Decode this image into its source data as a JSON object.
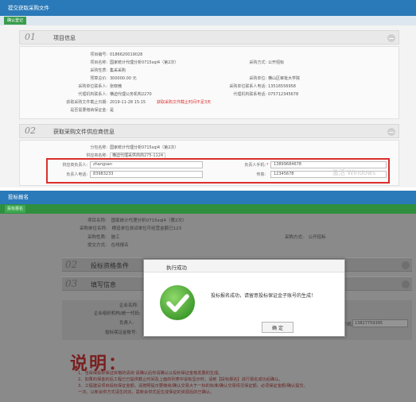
{
  "panel1": {
    "title": "提交获取采购文件",
    "toolbar": {
      "confirm_label": "确认登记"
    },
    "section1": {
      "num": "01",
      "title": "项目信息",
      "fields_left": [
        {
          "label": "项目编号:",
          "value": "0186620019028"
        },
        {
          "label": "项目名称:",
          "value": "国家统计代理分析0715sql4（第2次）"
        },
        {
          "label": "采购性质:",
          "value": "集采采购"
        },
        {
          "label": "预算总价:",
          "value": "300000.00 元"
        },
        {
          "label": "采购单位联系人:",
          "value": "张晓楠"
        },
        {
          "label": "代理机构联系人:",
          "value": "横迫代理公务机构2270"
        },
        {
          "label": "获取采购文件截止日期:",
          "value": "2019-11-28 15:15"
        },
        {
          "label": "是否需要缴纳保证金:",
          "value": "是"
        }
      ],
      "deadline_note": "获取采购文件截止时间不足3天",
      "fields_right": [
        {
          "label": "采购方式:",
          "value": "公开招标"
        },
        {
          "label": "采购单位:",
          "value": "横山区审批大学院"
        },
        {
          "label": "采购单位联系人电话:",
          "value": "13516556958"
        },
        {
          "label": "代理机构联系电话:",
          "value": "075712345678"
        }
      ]
    },
    "section2": {
      "num": "02",
      "title": "获取采购文件供应商信息",
      "fields": [
        {
          "label": "分包名称:",
          "value": "国家统计代理分析0715sql4（第2次）"
        },
        {
          "label": "供应商名称:",
          "value": "横迫代理采供商商275-1124"
        }
      ],
      "form": {
        "contact_label": "供应商负责人:",
        "contact_value": "zhangsan",
        "phone_label": "负责人电话:",
        "phone_value": "83983233",
        "mobile_label": "负责人手机:",
        "mobile_value": "13899684678",
        "fax_label": "传真:",
        "fax_value": "12345678",
        "required_mark": "*"
      },
      "watermark": "激活 Windows"
    }
  },
  "panel2": {
    "title": "投标报名",
    "toolbar": {
      "sign_label": "投标报名"
    },
    "rows": [
      {
        "label": "项目名称:",
        "value": "国家统计代理分析0715sql4（第2次）"
      },
      {
        "label": "采购单位名称:",
        "value": "横迫单位测试单位可经营金额已123"
      },
      {
        "label": "采购性质:",
        "value": "施工"
      },
      {
        "label": "采购方式:",
        "value": "公开招标"
      },
      {
        "label": "提交方式:",
        "value": "在线报名"
      }
    ],
    "section2": {
      "num": "02",
      "title": "投标资格条件"
    },
    "section3": {
      "num": "03",
      "title": "填写信息"
    },
    "form_labels": [
      "企业名称:",
      "企业组织机构/统一代码:",
      "负责人:",
      "投标保证金账号:"
    ],
    "mobile_label": "手机:",
    "mobile_value": "13827759395",
    "note_title": "说明：",
    "notes": [
      "1、当保保投标保证资格的请询 请确认后你请确认以投标保证金格发展的生成。",
      "2、如果的保金的后工程已已提供截止时间及上面的列表中说有显示时，请到【投标报名】进行报名成功后确认。",
      "3、工程建设项目投标保证金额，请按照提示要缴纳/确认交易大于一标的标准/确认交易情况保证额，必须保证金额/确认提交。",
      "一次。以新会供方式请生的完，需新会供式后生成保证的资源后的已确认。"
    ],
    "modal": {
      "title": "执行成功",
      "message": "投标报名成功，请留意投标保证金子账号的生成！",
      "ok_label": "确 定"
    }
  },
  "colors": {
    "titlebar": "#2a79b8",
    "toolbar_green": "#2f8f3f",
    "highlight_red": "#d9302c",
    "success_green": "#5bb947"
  },
  "icons": {
    "success": "check-circle-icon",
    "collapse": "collapse-icon"
  }
}
